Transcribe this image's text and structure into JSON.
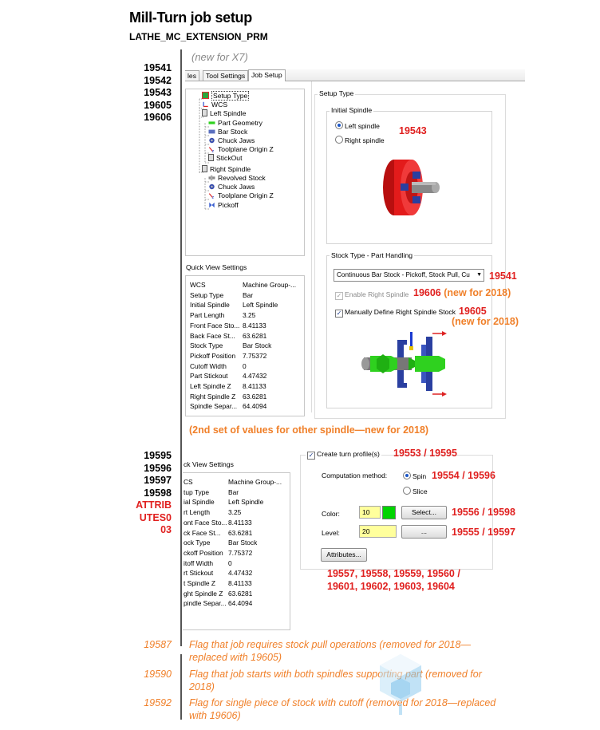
{
  "header": {
    "title": "Mill-Turn job setup",
    "subtitle": "LATHE_MC_EXTENSION_PRM"
  },
  "colors": {
    "red_callout": "#e0201f",
    "orange_note": "#f0802a",
    "chuck_red": "#e31b1b",
    "part_green": "#2fd11f",
    "color_swatch": "#00d400",
    "field_yellow": "#ffff9c"
  },
  "section1": {
    "new_note": "(new for X7)",
    "params": [
      "19541",
      "19542",
      "19543",
      "19605",
      "19606"
    ],
    "tabs": [
      "les",
      "Tool Settings",
      "Job Setup"
    ],
    "tree": [
      {
        "label": "Setup Type",
        "icon": "setup-type-icon"
      },
      {
        "label": "WCS",
        "icon": "wcs-axes-icon"
      },
      {
        "label": "Left Spindle",
        "icon": "spindle-icon"
      },
      {
        "label": "Part Geometry",
        "icon": "part-geometry-icon"
      },
      {
        "label": "Bar Stock",
        "icon": "bar-stock-icon"
      },
      {
        "label": "Chuck Jaws",
        "icon": "chuck-jaws-icon"
      },
      {
        "label": "Toolplane Origin Z",
        "icon": "toolplane-icon"
      },
      {
        "label": "StickOut",
        "icon": "stickout-icon"
      },
      {
        "label": "Right Spindle",
        "icon": "spindle-icon"
      },
      {
        "label": "Revolved Stock",
        "icon": "revolved-stock-icon"
      },
      {
        "label": "Chuck Jaws",
        "icon": "chuck-jaws-icon"
      },
      {
        "label": "Toolplane Origin Z",
        "icon": "toolplane-icon"
      },
      {
        "label": "Pickoff",
        "icon": "pickoff-icon"
      }
    ],
    "quick_view_title": "Quick View Settings",
    "quick_view": [
      [
        "WCS",
        "Machine Group-..."
      ],
      [
        "Setup Type",
        "Bar"
      ],
      [
        "Initial Spindle",
        "Left Spindle"
      ],
      [
        "Part Length",
        "3.25"
      ],
      [
        "Front Face Sto...",
        "8.41133"
      ],
      [
        "Back Face St...",
        "63.6281"
      ],
      [
        "Stock Type",
        "Bar Stock"
      ],
      [
        "Pickoff Position",
        "7.75372"
      ],
      [
        "Cutoff Width",
        "0"
      ],
      [
        "Part Stickout",
        "4.47432"
      ],
      [
        "Left Spindle Z",
        "8.41133"
      ],
      [
        "Right Spindle Z",
        "63.6281"
      ],
      [
        "Spindle Separ...",
        "64.4094"
      ]
    ],
    "setup_type_label": "Setup Type",
    "initial_spindle_label": "Initial Spindle",
    "left_spindle": "Left spindle",
    "right_spindle": "Right spindle",
    "callout_19543": "19543",
    "stock_type_label": "Stock Type - Part Handling",
    "stock_combo_value": "Continuous Bar Stock - Pickoff, Stock Pull, Cu",
    "callout_19541": "19541",
    "enable_right_spindle": "Enable Right Spindle",
    "callout_19606": "19606",
    "callout_19606_new": "(new for 2018)",
    "manually_define": "Manually Define Right Spindle Stock",
    "callout_19605": "19605",
    "callout_19605_new": "(new for 2018)"
  },
  "second_set_note": "(2nd set of values for other spindle—new for 2018)",
  "section2": {
    "params": [
      "19595",
      "19596",
      "19597",
      "19598"
    ],
    "params_red": [
      "ATTRIB",
      "UTES0",
      "03"
    ],
    "quick_view_title": "ck View Settings",
    "quick_view": [
      [
        "CS",
        "Machine Group-..."
      ],
      [
        "tup Type",
        "Bar"
      ],
      [
        "ial Spindle",
        "Left Spindle"
      ],
      [
        "rt Length",
        "3.25"
      ],
      [
        "ont Face Sto...",
        "8.41133"
      ],
      [
        "ck Face St...",
        "63.6281"
      ],
      [
        "ock Type",
        "Bar Stock"
      ],
      [
        "ckoff Position",
        "7.75372"
      ],
      [
        "itoff Width",
        "0"
      ],
      [
        "rt Stickout",
        "4.47432"
      ],
      [
        "t Spindle Z",
        "8.41133"
      ],
      [
        "ght Spindle Z",
        "63.6281"
      ],
      [
        "pindle Separ...",
        "64.4094"
      ]
    ],
    "create_turn_profile": "Create turn profile(s)",
    "callout_create": "19553 / 19595",
    "computation_method": "Computation method:",
    "spin": "Spin",
    "slice": "Slice",
    "callout_method": "19554 / 19596",
    "color_label": "Color:",
    "color_value": "10",
    "select_button": "Select...",
    "callout_color": "19556 / 19598",
    "level_label": "Level:",
    "level_value": "20",
    "level_button": "...",
    "callout_level": "19555 / 19597",
    "attributes_button": "Attributes...",
    "callout_attributes_1": "19557, 19558, 19559, 19560 /",
    "callout_attributes_2": "19601, 19602, 19603, 19604"
  },
  "notes": [
    {
      "param": "19587",
      "text1": "Flag that job requires stock pull operations (removed for 2018—",
      "text2": "replaced with 19605)"
    },
    {
      "param": "19590",
      "text1": "Flag that job starts with both spindles supporting part (removed for",
      "text2": "2018)"
    },
    {
      "param": "19592",
      "text1": "Flag for single piece of stock with cutoff (removed for 2018—replaced",
      "text2": "with 19606)"
    }
  ]
}
